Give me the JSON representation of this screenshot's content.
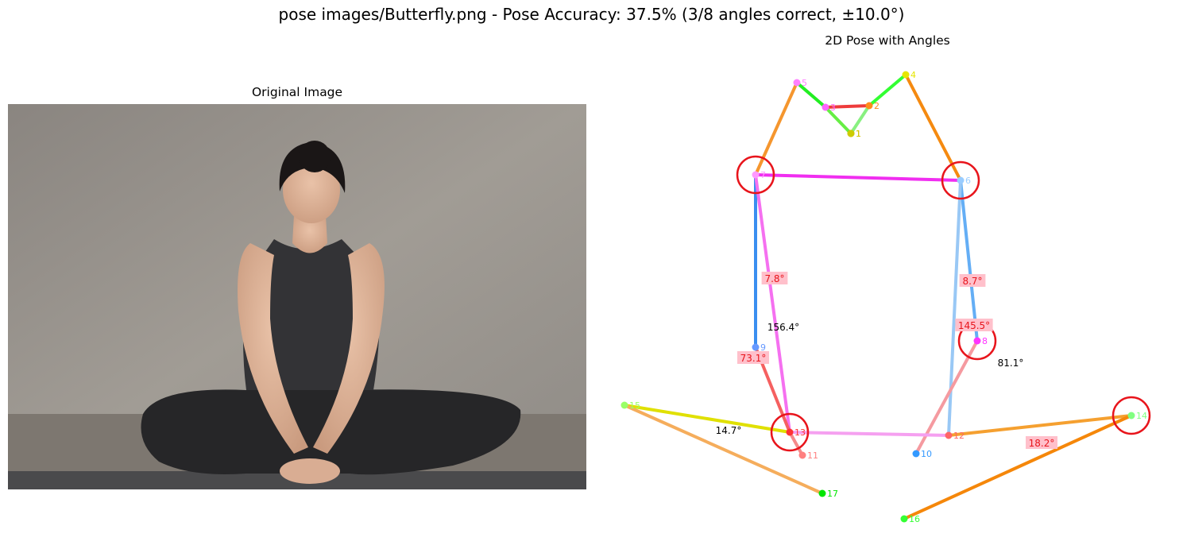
{
  "figure": {
    "title": "pose images/Butterfly.png - Pose Accuracy: 37.5% (3/8 angles correct, ±10.0°)"
  },
  "left_panel": {
    "title": "Original Image",
    "image_description": "woman in dark tank top and leggings seated in butterfly pose on a mat against a concrete wall"
  },
  "right_panel": {
    "title": "2D Pose with Angles",
    "colors": {
      "incorrect_circle": "#e8141b",
      "incorrect_label_bg": "#ffc0cb",
      "incorrect_label_text": "#e8141b",
      "correct_label_text": "#000000"
    },
    "keypoints": [
      {
        "id": "1",
        "color": "#ff8000"
      },
      {
        "id": "2",
        "color": "#ff8c1a"
      },
      {
        "id": "3",
        "color": "#ff66ff"
      },
      {
        "id": "4",
        "color": "#e6e600"
      },
      {
        "id": "5",
        "color": "#ff80ff"
      },
      {
        "id": "6",
        "color": "#99ccff"
      },
      {
        "id": "7",
        "color": "#ff99ff"
      },
      {
        "id": "8",
        "color": "#ff33ff"
      },
      {
        "id": "9",
        "color": "#6699ff"
      },
      {
        "id": "10",
        "color": "#3399ff"
      },
      {
        "id": "11",
        "color": "#ff8080"
      },
      {
        "id": "12",
        "color": "#ff6666"
      },
      {
        "id": "13",
        "color": "#ff3333"
      },
      {
        "id": "14",
        "color": "#80ff80"
      },
      {
        "id": "15",
        "color": "#99ff66"
      },
      {
        "id": "16",
        "color": "#33ff33"
      },
      {
        "id": "17",
        "color": "#00e600"
      },
      {
        "id": "1b",
        "color": "#cccc00",
        "label": "1"
      }
    ],
    "angles": [
      {
        "value": "7.8°",
        "correct": false
      },
      {
        "value": "8.7°",
        "correct": false
      },
      {
        "value": "156.4°",
        "correct": true
      },
      {
        "value": "145.5°",
        "correct": false
      },
      {
        "value": "73.1°",
        "correct": false
      },
      {
        "value": "81.1°",
        "correct": true
      },
      {
        "value": "14.7°",
        "correct": true
      },
      {
        "value": "18.2°",
        "correct": false
      }
    ]
  }
}
